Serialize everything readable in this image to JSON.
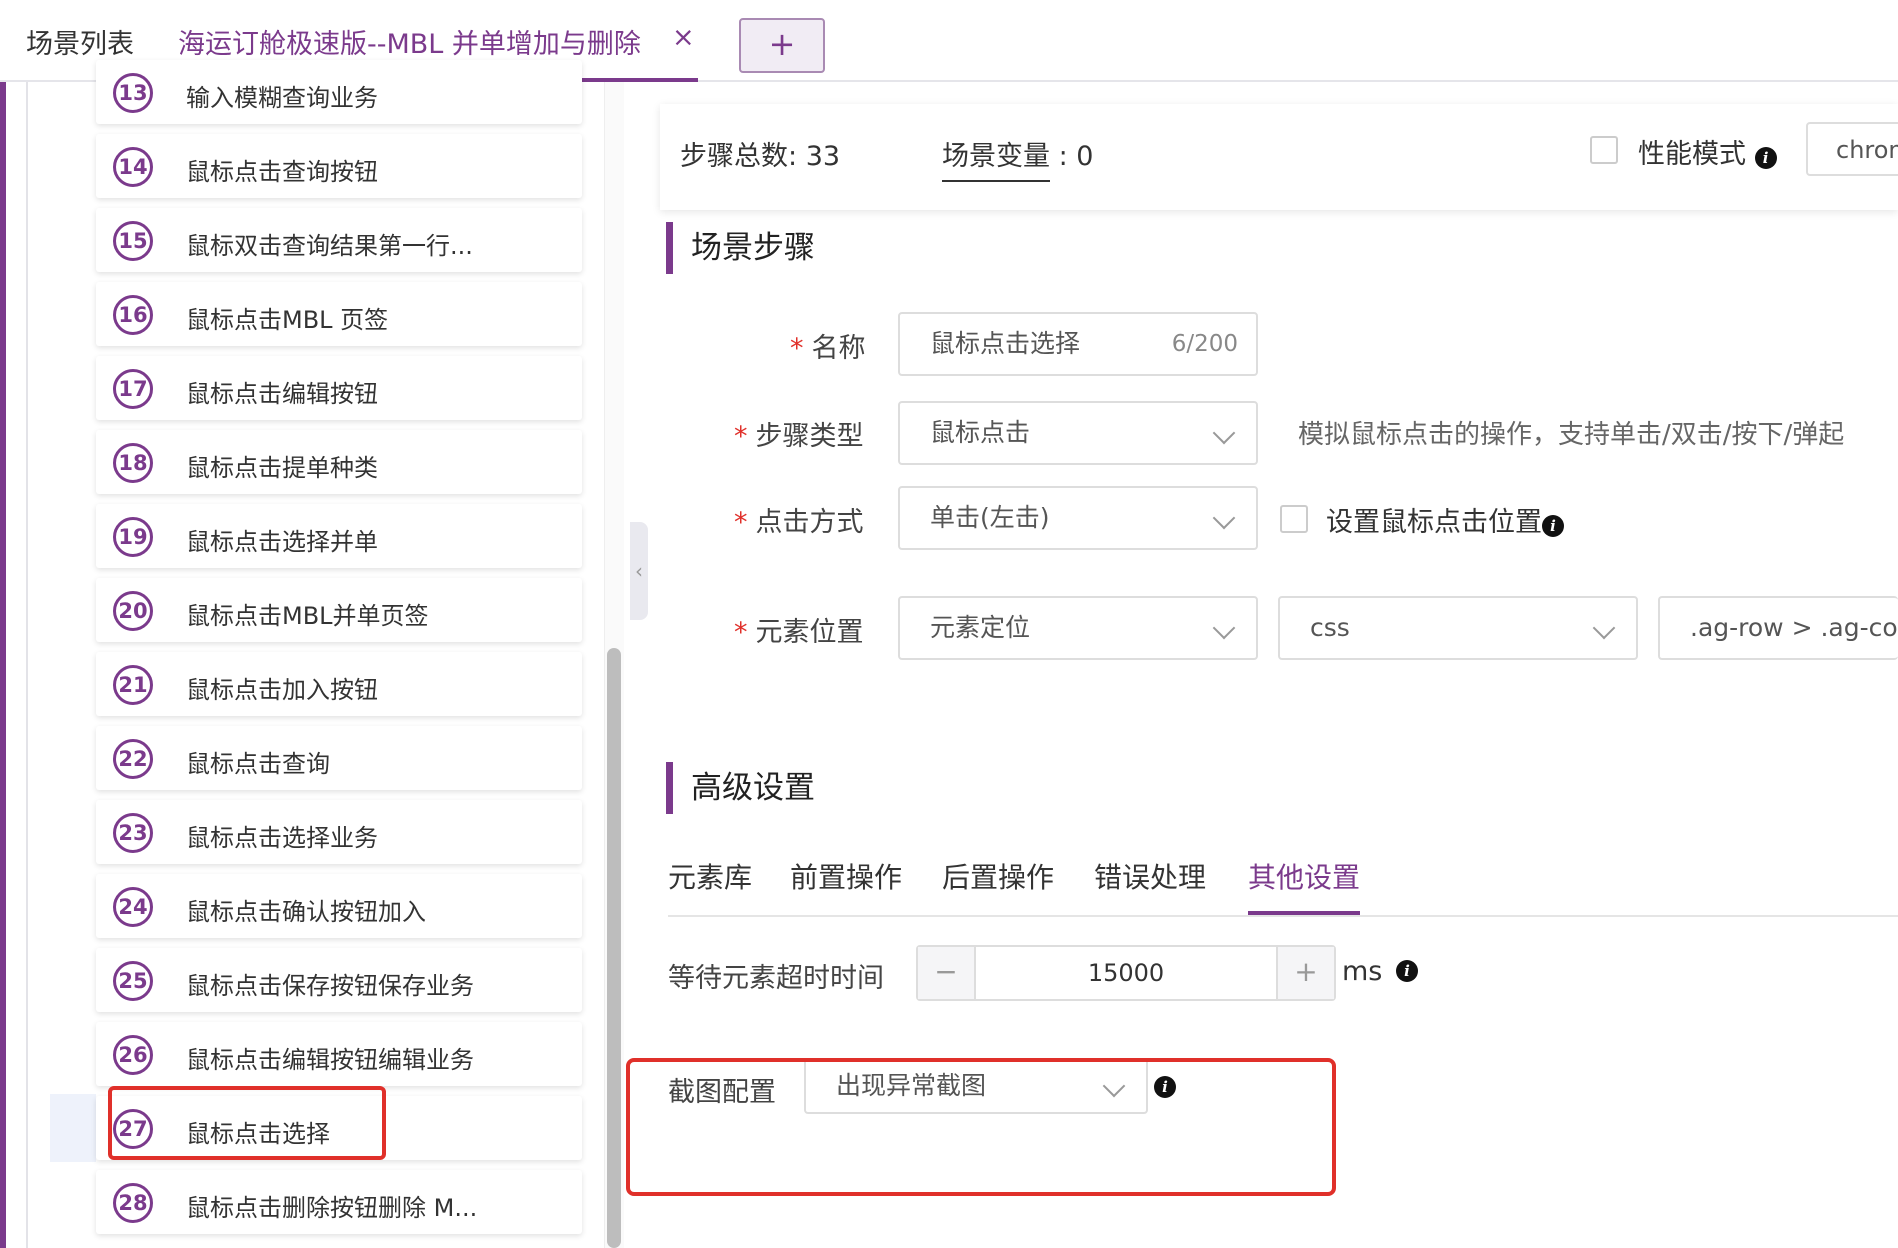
{
  "tabs": {
    "scene_list": "场景列表",
    "active": "海运订舱极速版--MBL 并单增加与删除",
    "close_symbol": "×",
    "add_symbol": "+"
  },
  "steps": [
    {
      "num": "13",
      "label": "输入模糊查询业务"
    },
    {
      "num": "14",
      "label": "鼠标点击查询按钮"
    },
    {
      "num": "15",
      "label": "鼠标双击查询结果第一行..."
    },
    {
      "num": "16",
      "label": "鼠标点击MBL 页签"
    },
    {
      "num": "17",
      "label": "鼠标点击编辑按钮"
    },
    {
      "num": "18",
      "label": "鼠标点击提单种类"
    },
    {
      "num": "19",
      "label": "鼠标点击选择并单"
    },
    {
      "num": "20",
      "label": "鼠标点击MBL并单页签"
    },
    {
      "num": "21",
      "label": "鼠标点击加入按钮"
    },
    {
      "num": "22",
      "label": "鼠标点击查询"
    },
    {
      "num": "23",
      "label": "鼠标点击选择业务"
    },
    {
      "num": "24",
      "label": "鼠标点击确认按钮加入"
    },
    {
      "num": "25",
      "label": "鼠标点击保存按钮保存业务"
    },
    {
      "num": "26",
      "label": "鼠标点击编辑按钮编辑业务"
    },
    {
      "num": "27",
      "label": "鼠标点击选择"
    },
    {
      "num": "28",
      "label": "鼠标点击删除按钮删除 M..."
    }
  ],
  "summary": {
    "steps_total_label": "步骤总数:",
    "steps_total_value": "33",
    "scene_vars_label": "场景变量",
    "scene_vars_sep": ":",
    "scene_vars_value": "0",
    "perf_mode_label": "性能模式",
    "browser_value": "chrome"
  },
  "section_steps_title": "场景步骤",
  "form": {
    "required_mark": "*",
    "name_label": "名称",
    "name_value": "鼠标点击选择",
    "name_counter": "6/200",
    "step_type_label": "步骤类型",
    "step_type_value": "鼠标点击",
    "step_type_hint": "模拟鼠标点击的操作，支持单击/双击/按下/弹起",
    "click_mode_label": "点击方式",
    "click_mode_value": "单击(左击)",
    "set_position_label": "设置鼠标点击位置",
    "element_pos_label": "元素位置",
    "element_pos_value": "元素定位",
    "locator_type_value": "css",
    "locator_expr_value": ".ag-row > .ag-column"
  },
  "section_advanced_title": "高级设置",
  "advanced_tabs": [
    "元素库",
    "前置操作",
    "后置操作",
    "错误处理",
    "其他设置"
  ],
  "advanced_active_tab": "其他设置",
  "other_settings": {
    "wait_timeout_label": "等待元素超时时间",
    "wait_timeout_value": "15000",
    "wait_timeout_unit": "ms",
    "minus_symbol": "−",
    "plus_symbol": "+",
    "screenshot_label": "截图配置",
    "screenshot_value": "出现异常截图"
  },
  "colors": {
    "accent": "#7b3a8c",
    "highlight": "#e0302a"
  }
}
